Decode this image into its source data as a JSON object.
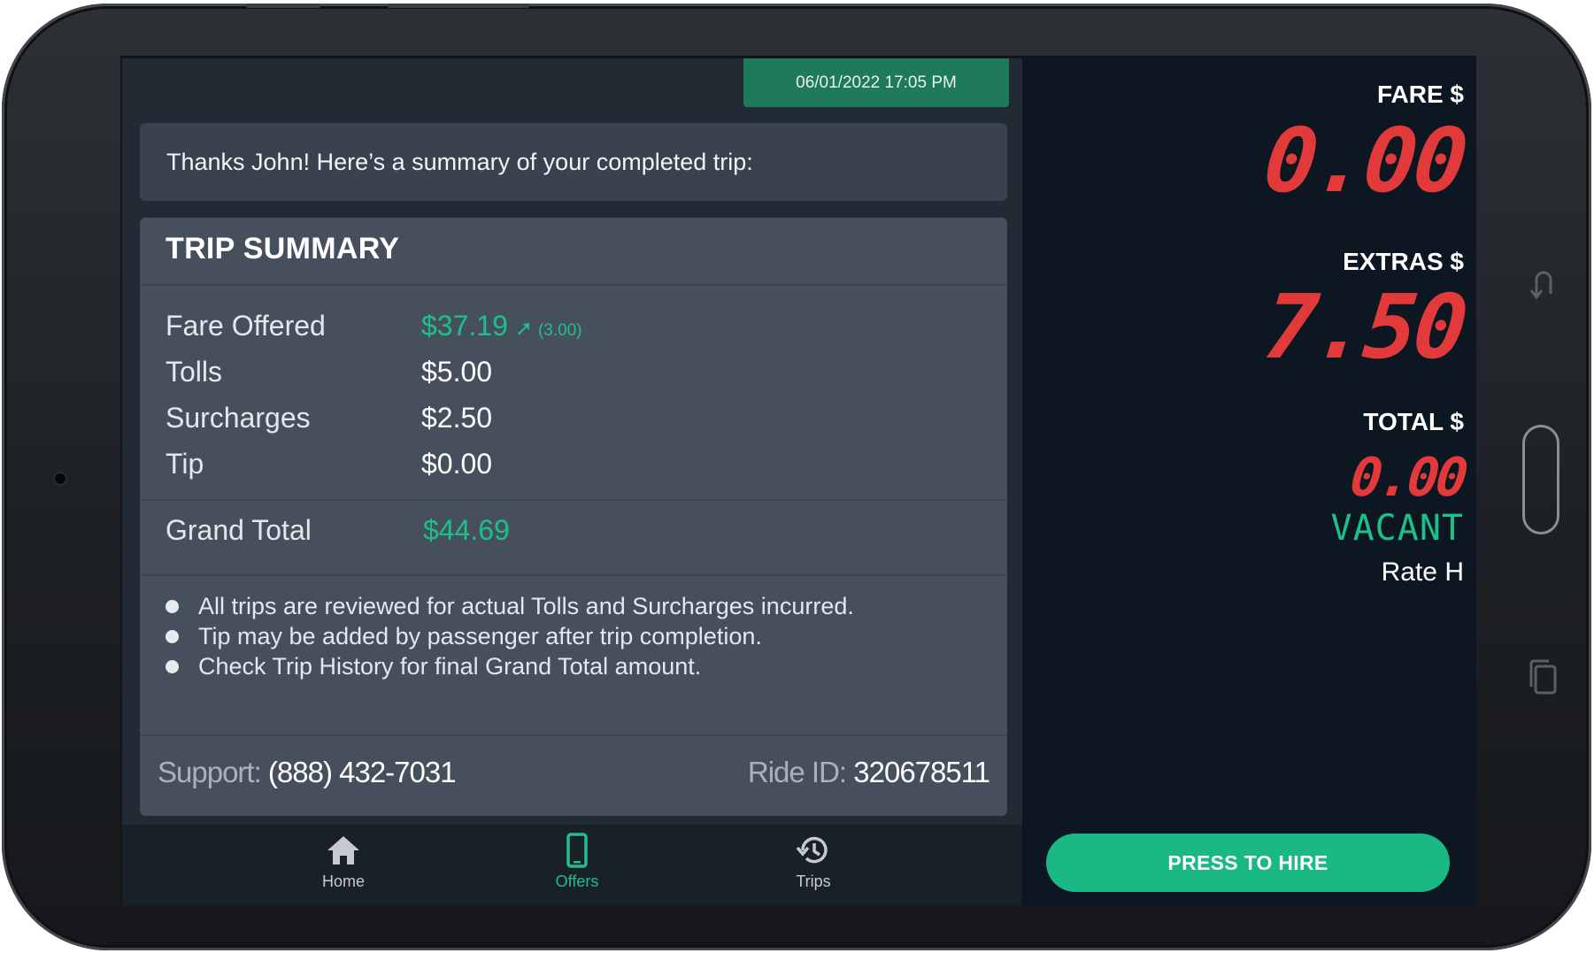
{
  "header": {
    "timestamp": "06/01/2022 17:05 PM"
  },
  "message": "Thanks John! Here’s a summary of your completed trip:",
  "trip_summary": {
    "title": "TRIP SUMMARY",
    "rows": [
      {
        "label": "Fare Offered",
        "value": "$37.19",
        "extra": "(3.00)",
        "extra_icon": "trend-up-icon"
      },
      {
        "label": "Tolls",
        "value": "$5.00"
      },
      {
        "label": "Surcharges",
        "value": "$2.50"
      },
      {
        "label": "Tip",
        "value": "$0.00"
      }
    ],
    "grand_total": {
      "label": "Grand Total",
      "value": "$44.69"
    },
    "notes": [
      "All trips are reviewed for actual Tolls and Surcharges incurred.",
      "Tip may be added by passenger after trip completion.",
      "Check Trip History for final Grand Total amount."
    ],
    "support": {
      "label": "Support:",
      "value": "(888) 432-7031"
    },
    "ride_id": {
      "label": "Ride ID:",
      "value": "320678511"
    }
  },
  "nav": {
    "items": [
      {
        "label": "Home",
        "icon": "home-icon",
        "active": false
      },
      {
        "label": "Offers",
        "icon": "phone-icon",
        "active": true
      },
      {
        "label": "Trips",
        "icon": "history-icon",
        "active": false
      }
    ]
  },
  "meter": {
    "fare_label": "FARE $",
    "fare_value": "0.00",
    "extras_label": "EXTRAS $",
    "extras_value": "7.50",
    "total_label": "TOTAL $",
    "total_value": "0.00",
    "status": "VACANT",
    "rate": "Rate H",
    "hire_button": "PRESS TO HIRE"
  },
  "colors": {
    "accent_green": "#1ec08a",
    "meter_red": "#e23a3a",
    "panel": "#46505d"
  }
}
